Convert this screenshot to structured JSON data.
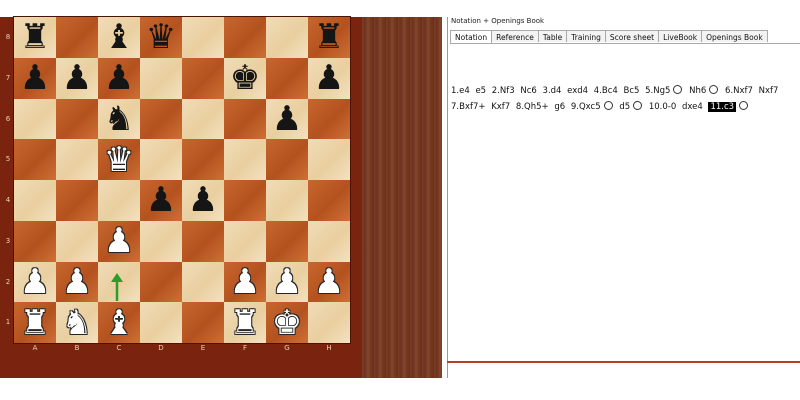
{
  "board": {
    "ranks": [
      "8",
      "7",
      "6",
      "5",
      "4",
      "3",
      "2",
      "1"
    ],
    "files": [
      "A",
      "B",
      "C",
      "D",
      "E",
      "F",
      "G",
      "H"
    ],
    "position": [
      [
        "r",
        "",
        "b",
        "q",
        "",
        "",
        "",
        "r"
      ],
      [
        "p",
        "p",
        "p",
        "",
        "",
        "k",
        "",
        "p"
      ],
      [
        "",
        "",
        "n",
        "",
        "",
        "",
        "p",
        ""
      ],
      [
        "",
        "",
        "Q",
        "",
        "",
        "",
        "",
        ""
      ],
      [
        "",
        "",
        "",
        "p",
        "p",
        "",
        "",
        ""
      ],
      [
        "",
        "",
        "P",
        "",
        "",
        "",
        "",
        ""
      ],
      [
        "P",
        "P",
        "",
        "",
        "",
        "P",
        "P",
        "P"
      ],
      [
        "R",
        "N",
        "B",
        "",
        "",
        "R",
        "K",
        ""
      ]
    ],
    "last_move_arrow": {
      "from": "c2",
      "to": "c3",
      "color": "#2a9d2a"
    }
  },
  "panel": {
    "title": "Notation + Openings Book",
    "tabs": [
      "Notation",
      "Reference",
      "Table",
      "Training",
      "Score sheet",
      "LiveBook",
      "Openings Book"
    ],
    "active_tab": "Notation"
  },
  "moves": [
    {
      "t": "1.e4"
    },
    {
      "t": "e5"
    },
    {
      "t": "2.Nf3"
    },
    {
      "t": "Nc6"
    },
    {
      "t": "3.d4"
    },
    {
      "t": "exd4"
    },
    {
      "t": "4.Bc4"
    },
    {
      "t": "Bc5"
    },
    {
      "t": "5.Ng5",
      "circle": true
    },
    {
      "t": "Nh6",
      "circle": true
    },
    {
      "t": "6.Nxf7"
    },
    {
      "t": "Nxf7"
    },
    {
      "t": "7.Bxf7+"
    },
    {
      "t": "Kxf7"
    },
    {
      "t": "8.Qh5+"
    },
    {
      "t": "g6"
    },
    {
      "t": "9.Qxc5",
      "circle": true
    },
    {
      "t": "d5",
      "circle": true
    },
    {
      "t": "10.0-0"
    },
    {
      "t": "dxe4"
    },
    {
      "t": "11.c3",
      "current": true,
      "circle": true
    }
  ],
  "colors": {
    "light_square": "#eed6ae",
    "dark_square": "#c0602a",
    "frame": "#7a2410",
    "wood": "#76391f"
  }
}
